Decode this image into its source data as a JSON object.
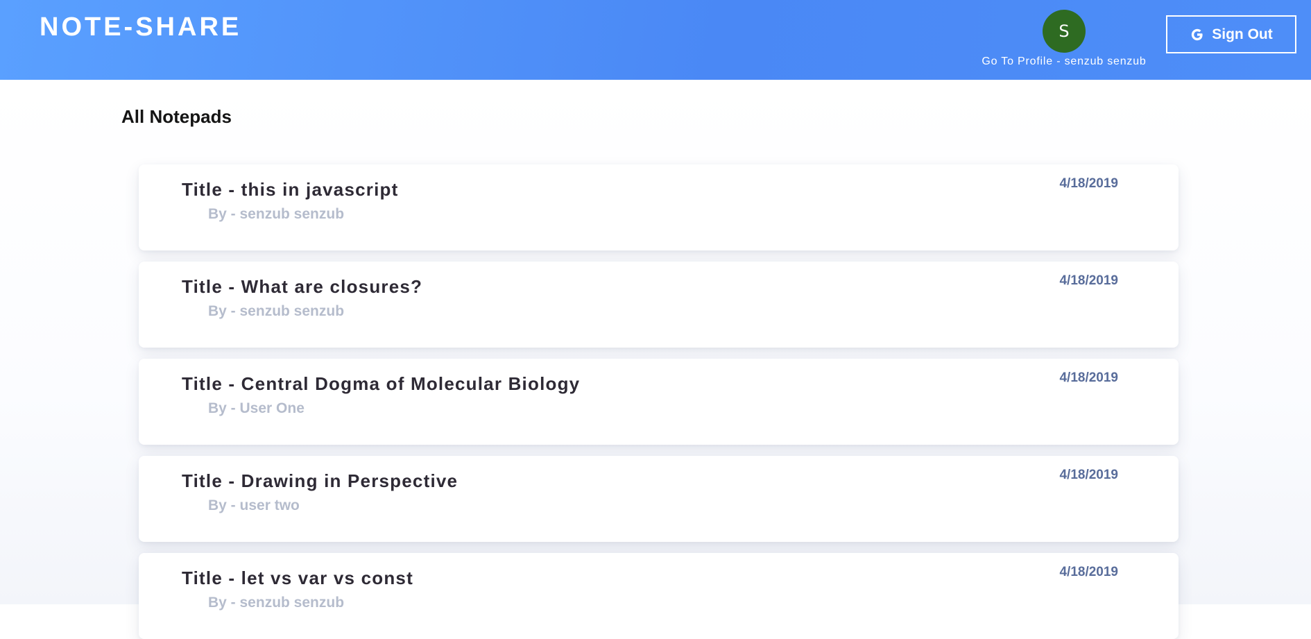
{
  "header": {
    "brand": "NOTE-SHARE",
    "avatar_initial": "S",
    "profile_link": "Go To Profile - senzub senzub",
    "sign_out_label": "Sign Out",
    "sign_out_icon": "google-g-icon"
  },
  "main": {
    "section_title": "All Notepads",
    "notes": [
      {
        "title": "Title - this in javascript",
        "author": "By - senzub senzub",
        "date": "4/18/2019"
      },
      {
        "title": "Title - What are closures?",
        "author": "By - senzub senzub",
        "date": "4/18/2019"
      },
      {
        "title": "Title - Central Dogma of Molecular Biology",
        "author": "By - User One",
        "date": "4/18/2019"
      },
      {
        "title": "Title - Drawing in Perspective",
        "author": "By - user two",
        "date": "4/18/2019"
      },
      {
        "title": "Title - let vs var vs const",
        "author": "By - senzub senzub",
        "date": "4/18/2019"
      }
    ]
  },
  "colors": {
    "header_gradient_start": "#5aa0ff",
    "header_gradient_end": "#4a88f5",
    "avatar_bg": "#2e6b22",
    "title_text": "#2e2a35",
    "author_text": "#b5bccc",
    "date_text": "#586c9a"
  }
}
